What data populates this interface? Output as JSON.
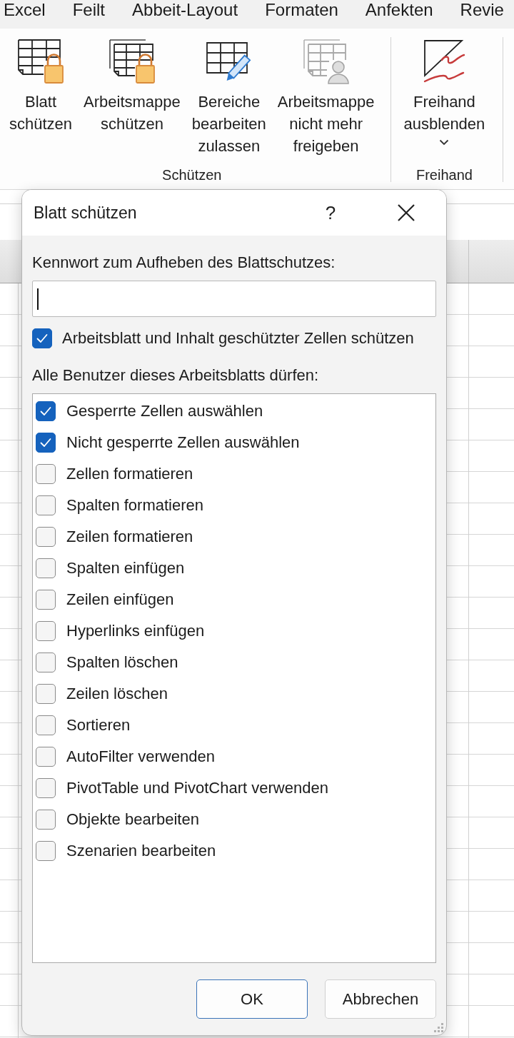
{
  "menu_bar": {
    "tabs": [
      "Excel",
      "Feilt",
      "Abbeit-Layout",
      "Formaten",
      "Anfekten",
      "Revie"
    ]
  },
  "ribbon": {
    "groups": [
      {
        "label": "Schützen",
        "buttons": [
          {
            "kind": "sheetlock",
            "label": "Blatt\nschützen"
          },
          {
            "kind": "booklock",
            "label": "Arbeitsmappe\nschützen"
          },
          {
            "kind": "editranges",
            "label": "Bereiche\nbearbeiten\nzulassen"
          },
          {
            "kind": "unshare",
            "label": "Arbeitsmappe\nnicht mehr\nfreigeben"
          }
        ]
      },
      {
        "label": "Freihand",
        "buttons": [
          {
            "kind": "ink",
            "label": "Freihand\nausblenden",
            "has_menu": true
          }
        ]
      }
    ]
  },
  "dialog": {
    "title": "Blatt schützen",
    "help_button": "?",
    "password": {
      "label": "Kennwort zum Aufheben des Blattschutzes:",
      "focused": true
    },
    "protect": {
      "label": "Arbeitsblatt und Inhalt geschützter Zellen schützen",
      "checked": true
    },
    "permissions_label": "Alle Benutzer dieses Arbeitsblatts dürfen:",
    "permissions": [
      {
        "label": "Gesperrte Zellen auswählen",
        "checked": true
      },
      {
        "label": "Nicht gesperrte Zellen auswählen",
        "checked": true
      },
      {
        "label": "Zellen formatieren",
        "checked": false
      },
      {
        "label": "Spalten formatieren",
        "checked": false
      },
      {
        "label": "Zeilen formatieren",
        "checked": false
      },
      {
        "label": "Spalten einfügen",
        "checked": false
      },
      {
        "label": "Zeilen einfügen",
        "checked": false
      },
      {
        "label": "Hyperlinks einfügen",
        "checked": false
      },
      {
        "label": "Spalten löschen",
        "checked": false
      },
      {
        "label": "Zeilen löschen",
        "checked": false
      },
      {
        "label": "Sortieren",
        "checked": false
      },
      {
        "label": "AutoFilter verwenden",
        "checked": false
      },
      {
        "label": "PivotTable und PivotChart verwenden",
        "checked": false
      },
      {
        "label": "Objekte bearbeiten",
        "checked": false
      },
      {
        "label": "Szenarien bearbeiten",
        "checked": false
      }
    ],
    "buttons": [
      {
        "label": "OK",
        "default": true
      },
      {
        "label": "Abbrechen",
        "default": false
      }
    ]
  }
}
